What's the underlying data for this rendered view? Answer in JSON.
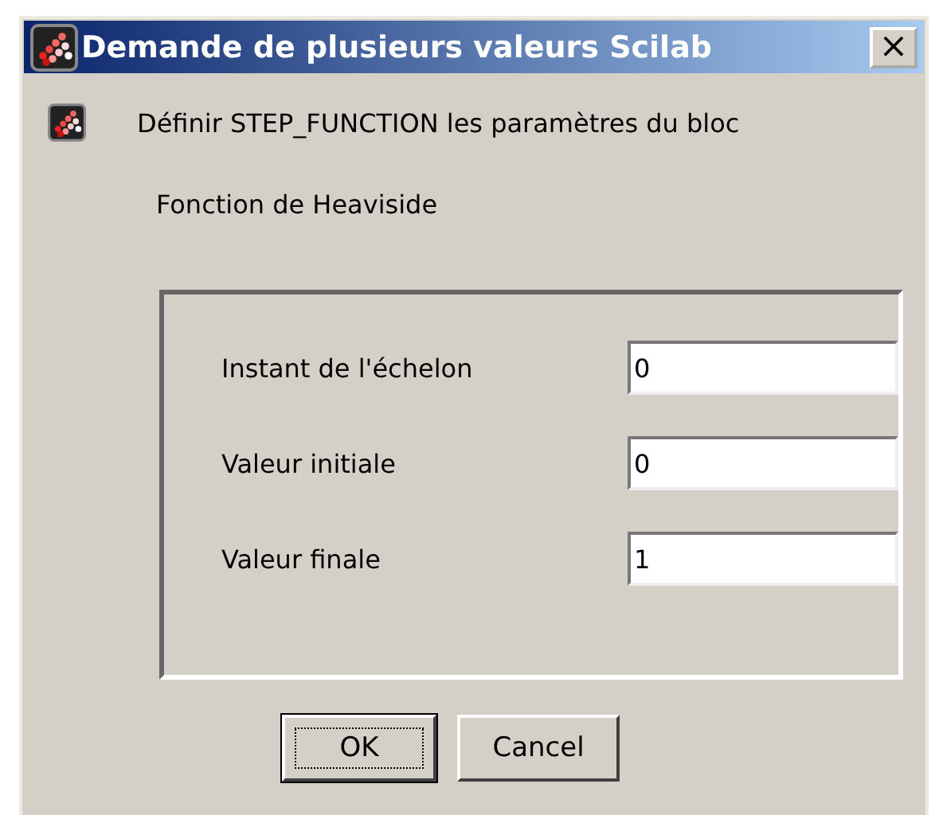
{
  "window": {
    "title": "Demande de plusieurs valeurs Scilab",
    "close": "×"
  },
  "message": "Définir STEP_FUNCTION les paramètres du bloc",
  "description": "Fonction de Heaviside",
  "fields": [
    {
      "label": "Instant de l'échelon",
      "value": "0"
    },
    {
      "label": "Valeur initiale",
      "value": "0"
    },
    {
      "label": "Valeur finale",
      "value": "1"
    }
  ],
  "buttons": [
    {
      "label": "OK",
      "focused": true
    },
    {
      "label": "Cancel",
      "focused": false
    }
  ]
}
